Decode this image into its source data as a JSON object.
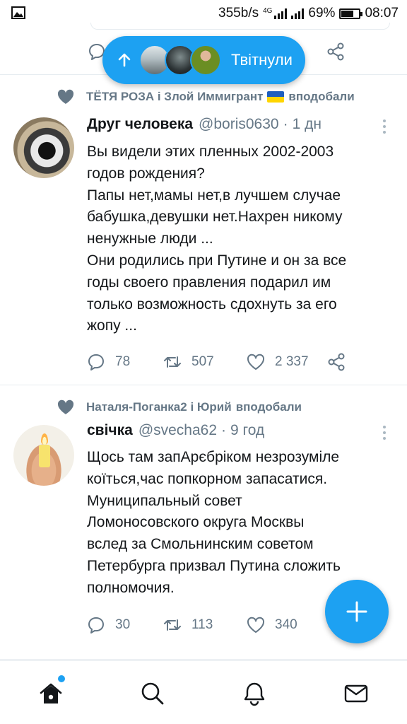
{
  "status_bar": {
    "speed": "355b/s",
    "network": "4G",
    "battery_percent": "69%",
    "battery_level": 0.69,
    "time": "08:07"
  },
  "new_tweets_pill": {
    "label": "Твітнули"
  },
  "tweets": [
    {
      "social_context": {
        "names": "ТЁТЯ РОЗА і Злой Иммигрант",
        "action": "вподобали",
        "flag": "ukraine-flag"
      },
      "author_name": "Друг человека",
      "handle": "@boris0630",
      "separator": "·",
      "time": "1 дн",
      "lines": [
        "Вы видели этих пленных 2002-2003",
        "годов рождения?",
        "Папы нет,мамы нет,в лучшем случае",
        "бабушка,девушки нет.Нахрен никому",
        "ненужные люди ...",
        "Они родились при Путине и он за все",
        "годы своего правления подарил им",
        "только возможность сдохнуть за его",
        "жопу ..."
      ],
      "replies": "78",
      "retweets": "507",
      "likes": "2 337"
    },
    {
      "social_context": {
        "names": "Наталя-Поганка2 і Юрий",
        "action": "вподобали"
      },
      "author_name": "свічка",
      "handle": "@svecha62",
      "separator": "·",
      "time": "9 год",
      "lines": [
        "Щось там запАрєбріком незрозуміле",
        "коїться,час попкорном запасатися.",
        "Муниципальный совет",
        "Ломоносовского округа Москвы",
        "вслед за Смольнинским советом",
        "Петербурга призвал Путина сложить",
        "полномочия."
      ],
      "replies": "30",
      "retweets": "113",
      "likes": "340"
    }
  ],
  "colors": {
    "accent": "#1da1f2",
    "secondary_text": "#657786",
    "divider": "#e6ecf0",
    "icon_gray": "#657786"
  },
  "icons": {
    "status_image": "image-icon",
    "pill_arrow": "arrow-up-icon",
    "reply": "reply-icon",
    "retweet": "retweet-icon",
    "like": "heart-icon",
    "share": "share-icon",
    "more": "more-vertical-icon",
    "compose": "plus-icon",
    "home": "home-icon",
    "search": "search-icon",
    "notifications": "bell-icon",
    "messages": "mail-icon"
  }
}
